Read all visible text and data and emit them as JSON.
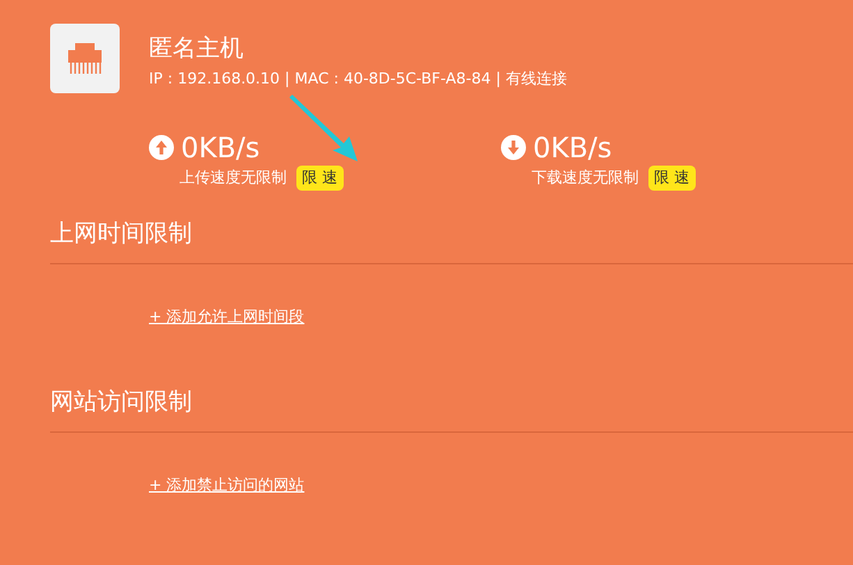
{
  "host": {
    "name": "匿名主机",
    "details": "IP : 192.168.0.10 | MAC : 40-8D-5C-BF-A8-84 | 有线连接"
  },
  "speeds": [
    {
      "kind": "upload",
      "value": "0KB/s",
      "status": "上传速度无限制",
      "button": "限 速"
    },
    {
      "kind": "download",
      "value": "0KB/s",
      "status": "下载速度无限制",
      "button": "限 速"
    }
  ],
  "sections": [
    {
      "title": "上网时间限制",
      "link": "+ 添加允许上网时间段"
    },
    {
      "title": "网站访问限制",
      "link": "+ 添加禁止访问的网站"
    }
  ]
}
